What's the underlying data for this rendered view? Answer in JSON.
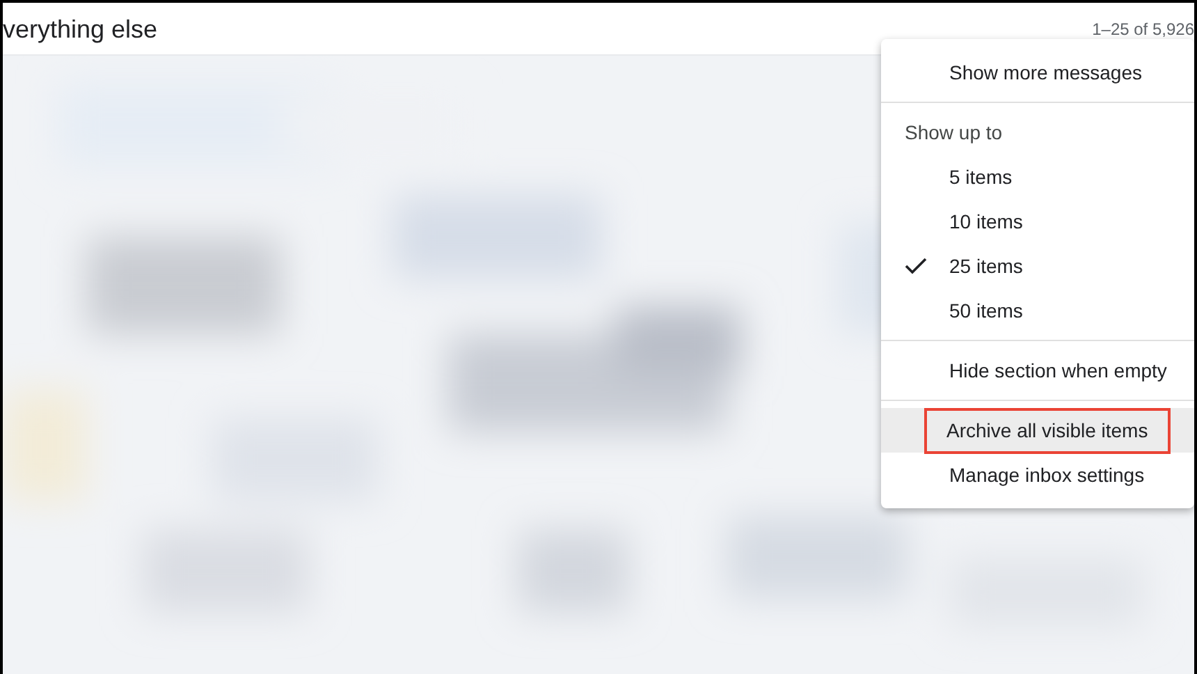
{
  "section": {
    "title": "verything else",
    "pagination": "1–25 of 5,926"
  },
  "menu": {
    "items": [
      {
        "kind": "action",
        "label": "Show more messages",
        "hovered": false,
        "outlined": false
      },
      {
        "kind": "divider"
      },
      {
        "kind": "header",
        "label": "Show up to"
      },
      {
        "kind": "option",
        "label": "5 items",
        "checked": false
      },
      {
        "kind": "option",
        "label": "10 items",
        "checked": false
      },
      {
        "kind": "option",
        "label": "25 items",
        "checked": true
      },
      {
        "kind": "option",
        "label": "50 items",
        "checked": false
      },
      {
        "kind": "divider"
      },
      {
        "kind": "action",
        "label": "Hide section when empty",
        "hovered": false,
        "outlined": false
      },
      {
        "kind": "divider"
      },
      {
        "kind": "action",
        "label": "Archive all visible items",
        "hovered": true,
        "outlined": true
      },
      {
        "kind": "action",
        "label": "Manage inbox settings",
        "hovered": false,
        "outlined": false
      }
    ]
  }
}
